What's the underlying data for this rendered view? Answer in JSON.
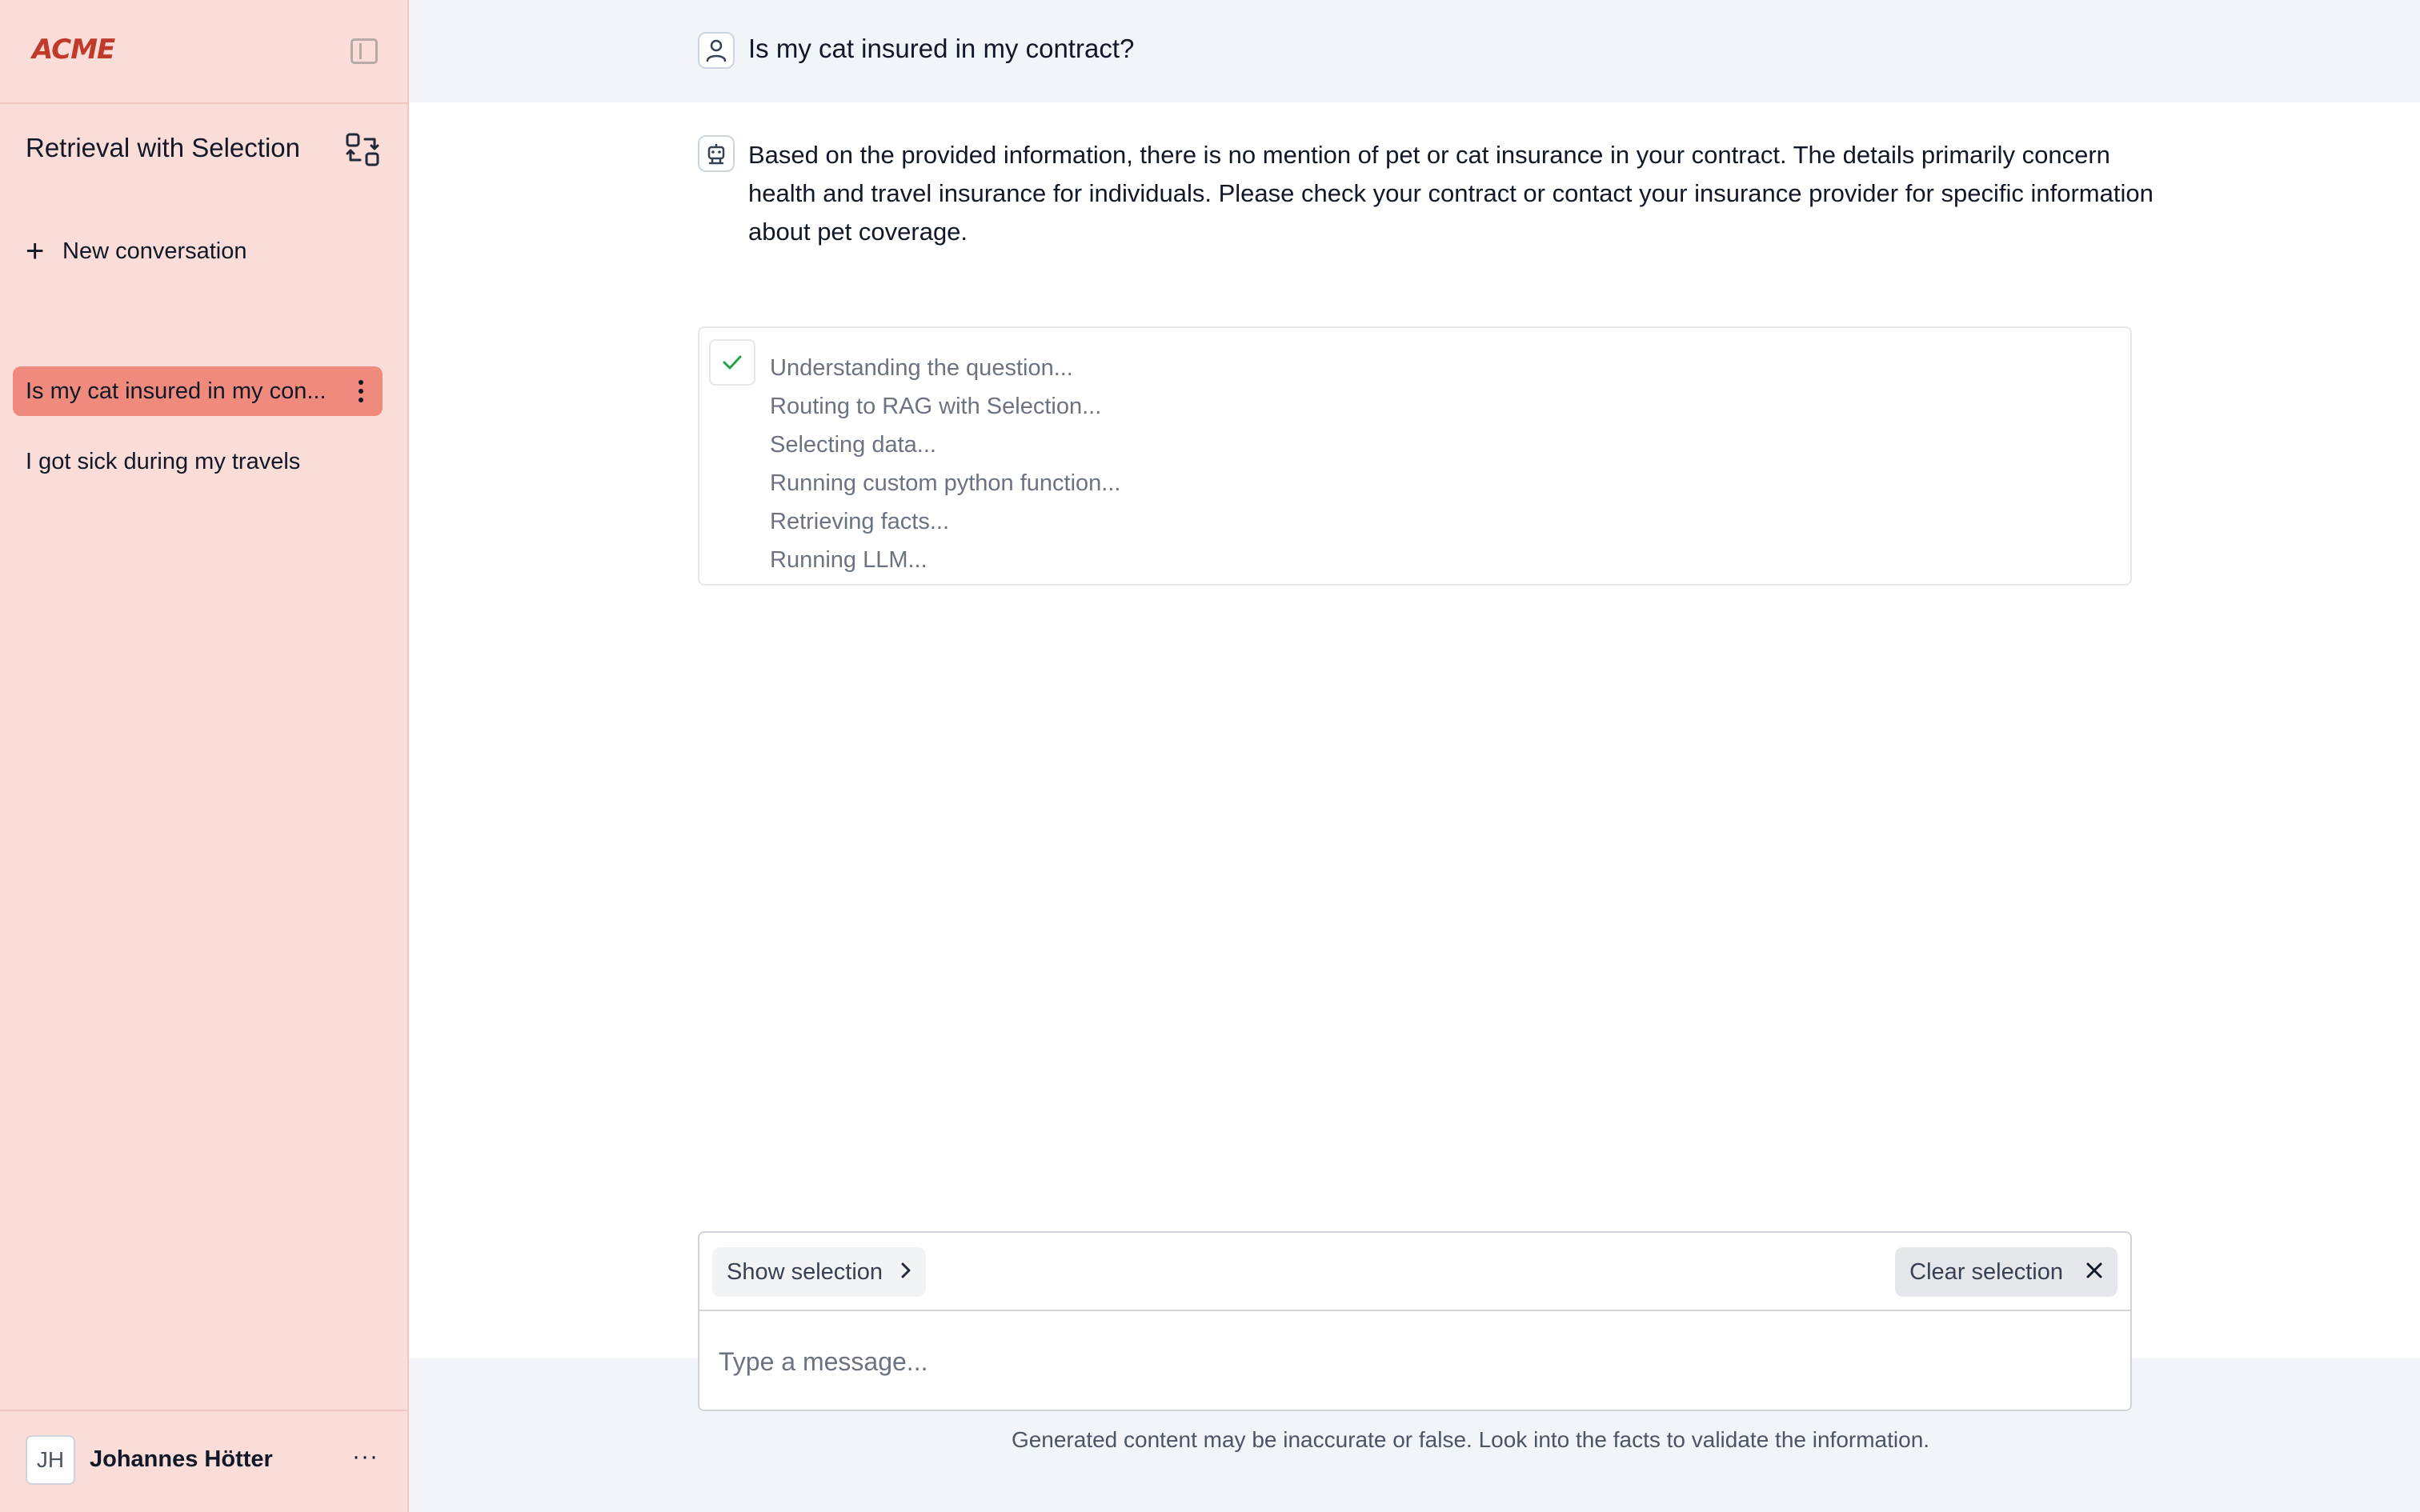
{
  "sidebar": {
    "logo": "ACME",
    "agent_title": "Retrieval with Selection",
    "new_conversation": "New conversation",
    "conversations": [
      {
        "label": "Is my cat insured in my con...",
        "active": true
      },
      {
        "label": "I got sick during my travels",
        "active": false
      }
    ],
    "user": {
      "initials": "JH",
      "name": "Johannes Hötter",
      "menu": "···"
    }
  },
  "chat": {
    "question": "Is my cat insured in my contract?",
    "answer": "Based on the provided information, there is no mention of pet or cat insurance in your contract. The details primarily concern health and travel insurance for individuals. Please check your contract or contact your insurance provider for specific information about pet coverage.",
    "steps": [
      "Understanding the question...",
      "Routing to RAG with Selection...",
      "Selecting data...",
      "Running custom python function...",
      "Retrieving facts...",
      "Running LLM..."
    ]
  },
  "composer": {
    "show_selection": "Show selection",
    "clear_selection": "Clear selection",
    "placeholder": "Type a message...",
    "disclaimer": "Generated content may be inaccurate or false. Look into the facts to validate the information."
  },
  "colors": {
    "sidebar_bg": "#fadcd8",
    "active_item": "#ef8a7c",
    "logo": "#c0392b",
    "check": "#22a34a"
  },
  "icons": [
    "sidebar-toggle-icon",
    "switch-agent-icon",
    "plus-icon",
    "kebab-icon",
    "user-icon",
    "bot-icon",
    "check-icon",
    "chevron-right-icon",
    "close-icon"
  ]
}
